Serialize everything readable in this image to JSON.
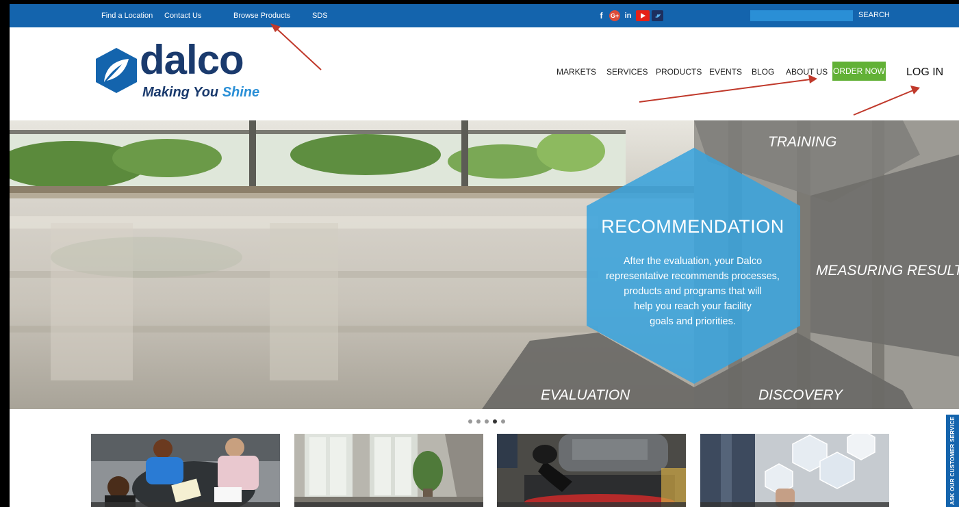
{
  "topbar": {
    "links": [
      "Find a Location",
      "Contact Us",
      "Browse Products",
      "SDS"
    ],
    "social_icons": [
      "facebook-icon",
      "google-plus-icon",
      "linkedin-icon",
      "youtube-icon",
      "twitter-icon"
    ],
    "search_placeholder": "",
    "search_button": "SEARCH"
  },
  "header": {
    "logo_word": "dalco",
    "tagline_part1": "Making You ",
    "tagline_part2": "Shine",
    "nav": [
      "MARKETS",
      "SERVICES",
      "PRODUCTS",
      "EVENTS",
      "BLOG",
      "ABOUT US"
    ],
    "order_now": "ORDER NOW",
    "login": "LOG IN"
  },
  "hero": {
    "training": "TRAINING",
    "measuring": "MEASURING RESULTS",
    "evaluation": "EVALUATION",
    "discovery": "DISCOVERY",
    "recommendation_title": "RECOMMENDATION",
    "recommendation_body": [
      "After the evaluation, your Dalco",
      "representative recommends processes,",
      "products and programs that will",
      "help you reach your facility",
      "goals and priorities."
    ]
  },
  "carousel": {
    "slide_count": 5,
    "active_slide": 4
  },
  "side_tab": "ASK OUR CUSTOMER SERVICE",
  "colors": {
    "topbar": "#1464ad",
    "brand_navy": "#1a3a6d",
    "accent_blue": "#2a8fd6",
    "order_green": "#62b136",
    "annotation_arrow": "#c0392b"
  }
}
